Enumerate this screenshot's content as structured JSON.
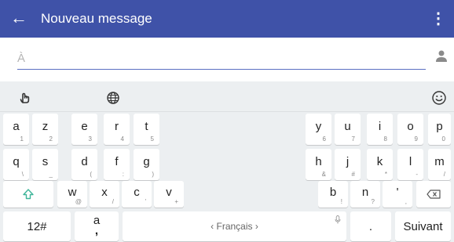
{
  "appbar": {
    "back_icon": "arrow-left-icon",
    "title": "Nouveau message",
    "menu_icon": "more-vert-icon",
    "color": "#3f52a8"
  },
  "recipient": {
    "placeholder": "À",
    "value": "",
    "contact_icon": "person-icon"
  },
  "keyboard": {
    "toolbar": {
      "gesture_icon": "hand-pointer-icon",
      "language_icon": "globe-icon",
      "emoji_icon": "smiley-icon"
    },
    "row1_left": [
      {
        "main": "a",
        "sub": "1"
      },
      {
        "main": "z",
        "sub": "2"
      },
      {
        "main": "e",
        "sub": "3"
      },
      {
        "main": "r",
        "sub": "4"
      },
      {
        "main": "t",
        "sub": "5"
      }
    ],
    "row1_right": [
      {
        "main": "y",
        "sub": "6"
      },
      {
        "main": "u",
        "sub": "7"
      },
      {
        "main": "i",
        "sub": "8"
      },
      {
        "main": "o",
        "sub": "9"
      },
      {
        "main": "p",
        "sub": "0"
      }
    ],
    "row2_left": [
      {
        "main": "q",
        "sub": "\\"
      },
      {
        "main": "s",
        "sub": "_"
      },
      {
        "main": "d",
        "sub": "("
      },
      {
        "main": "f",
        "sub": ":"
      },
      {
        "main": "g",
        "sub": ")"
      }
    ],
    "row2_right": [
      {
        "main": "h",
        "sub": "&"
      },
      {
        "main": "j",
        "sub": "#"
      },
      {
        "main": "k",
        "sub": "*"
      },
      {
        "main": "l",
        "sub": "-"
      },
      {
        "main": "m",
        "sub": "/"
      }
    ],
    "row3_left": [
      {
        "main": "w",
        "sub": "@"
      },
      {
        "main": "x",
        "sub": "/"
      },
      {
        "main": "c",
        "sub": "'"
      },
      {
        "main": "v",
        "sub": "+"
      }
    ],
    "row3_right": [
      {
        "main": "b",
        "sub": "!"
      },
      {
        "main": "n",
        "sub": "?"
      },
      {
        "main": "'",
        "sub": ""
      },
      {
        "main": "",
        "sub": ","
      }
    ],
    "shift_icon": "shift-arrow-icon",
    "backspace_icon": "backspace-icon",
    "symbols_label": "12#",
    "punct_key": {
      "main": "a",
      "sub": ","
    },
    "space_label": "‹ Français ›",
    "mic_icon": "microphone-icon",
    "period_label": ".",
    "action_label": "Suivant",
    "shift_color": "#3fb59a"
  }
}
